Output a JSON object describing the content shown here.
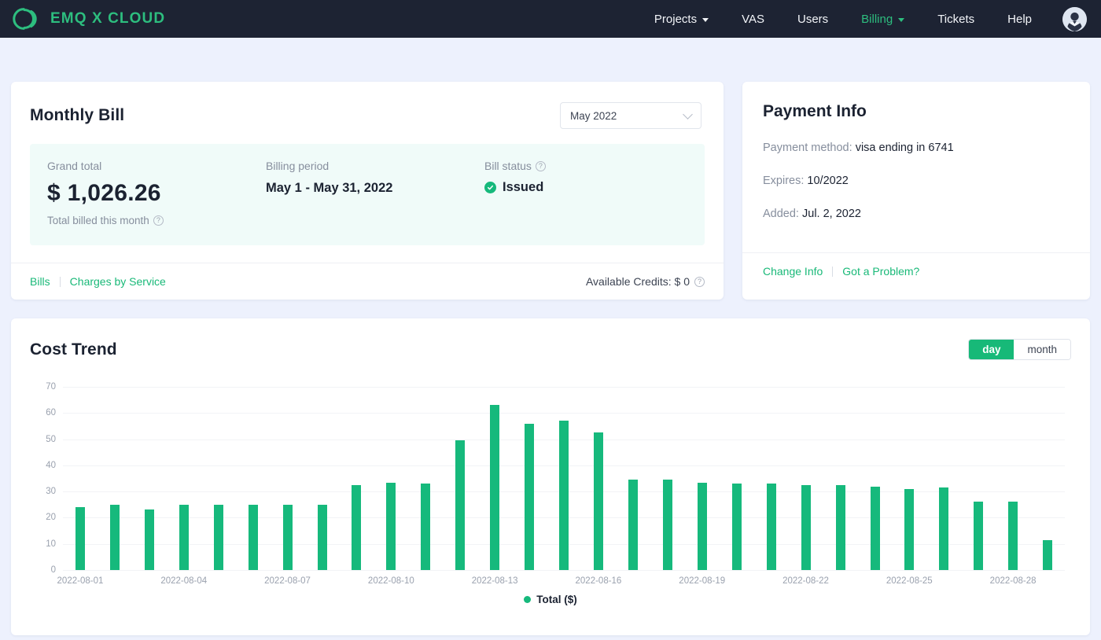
{
  "brand": {
    "name": "EMQ X CLOUD",
    "logo_icon": "emqx-logo-icon",
    "color": "#2dbe7f"
  },
  "nav": {
    "items": [
      {
        "label": "Projects",
        "has_caret": true,
        "active": false
      },
      {
        "label": "VAS",
        "has_caret": false,
        "active": false
      },
      {
        "label": "Users",
        "has_caret": false,
        "active": false
      },
      {
        "label": "Billing",
        "has_caret": true,
        "active": true
      },
      {
        "label": "Tickets",
        "has_caret": false,
        "active": false
      },
      {
        "label": "Help",
        "has_caret": false,
        "active": false
      }
    ],
    "avatar_icon": "user-avatar-icon"
  },
  "monthly_bill": {
    "title": "Monthly Bill",
    "month_select": {
      "value": "May  2022",
      "chevron_icon": "chevron-down-icon"
    },
    "grand_total_label": "Grand total",
    "grand_total_value": "$ 1,026.26",
    "grand_total_sub": "Total billed this month",
    "billing_period_label": "Billing period",
    "billing_period_value": "May 1 - May 31, 2022",
    "bill_status_label": "Bill status",
    "bill_status_value": "Issued",
    "status_icon": "check-circle-icon",
    "help_icon": "question-mark-icon",
    "footer": {
      "bills_link": "Bills",
      "charges_link": "Charges by Service",
      "credits_text": "Available Credits: $ 0"
    }
  },
  "payment_info": {
    "title": "Payment Info",
    "method_label": "Payment method:",
    "method_value": "visa ending in 6741",
    "expires_label": "Expires:",
    "expires_value": "10/2022",
    "added_label": "Added:",
    "added_value": "Jul. 2, 2022",
    "change_info_link": "Change Info",
    "problem_link": "Got a Problem?"
  },
  "cost_trend": {
    "title": "Cost Trend",
    "toggle": {
      "options": [
        "day",
        "month"
      ],
      "selected": "day"
    }
  },
  "chart_data": {
    "type": "bar",
    "title": "Cost Trend",
    "xlabel": "",
    "ylabel": "",
    "ylim": [
      0,
      70
    ],
    "yticks": [
      0,
      10,
      20,
      30,
      40,
      50,
      60,
      70
    ],
    "grid": true,
    "legend": {
      "position": "bottom",
      "entries": [
        "Total ($)"
      ]
    },
    "series_name": "Total ($)",
    "color": "#16b97c",
    "categories": [
      "2022-08-01",
      "2022-08-02",
      "2022-08-03",
      "2022-08-04",
      "2022-08-05",
      "2022-08-06",
      "2022-08-07",
      "2022-08-08",
      "2022-08-09",
      "2022-08-10",
      "2022-08-11",
      "2022-08-12",
      "2022-08-13",
      "2022-08-14",
      "2022-08-15",
      "2022-08-16",
      "2022-08-17",
      "2022-08-18",
      "2022-08-19",
      "2022-08-20",
      "2022-08-21",
      "2022-08-22",
      "2022-08-23",
      "2022-08-24",
      "2022-08-25",
      "2022-08-26",
      "2022-08-27",
      "2022-08-28",
      "2022-08-29"
    ],
    "values": [
      24,
      25,
      23,
      25,
      25,
      25,
      25,
      25,
      32.5,
      33.5,
      33,
      49.5,
      63,
      56,
      57,
      52.5,
      34.5,
      34.5,
      33.5,
      33,
      33,
      32.5,
      32.5,
      32,
      31,
      31.5,
      26,
      26,
      11.5
    ],
    "xtick_labels": [
      "2022-08-01",
      "2022-08-04",
      "2022-08-07",
      "2022-08-10",
      "2022-08-13",
      "2022-08-16",
      "2022-08-19",
      "2022-08-22",
      "2022-08-25",
      "2022-08-28"
    ],
    "xtick_indices": [
      0,
      3,
      6,
      9,
      12,
      15,
      18,
      21,
      24,
      27
    ]
  }
}
